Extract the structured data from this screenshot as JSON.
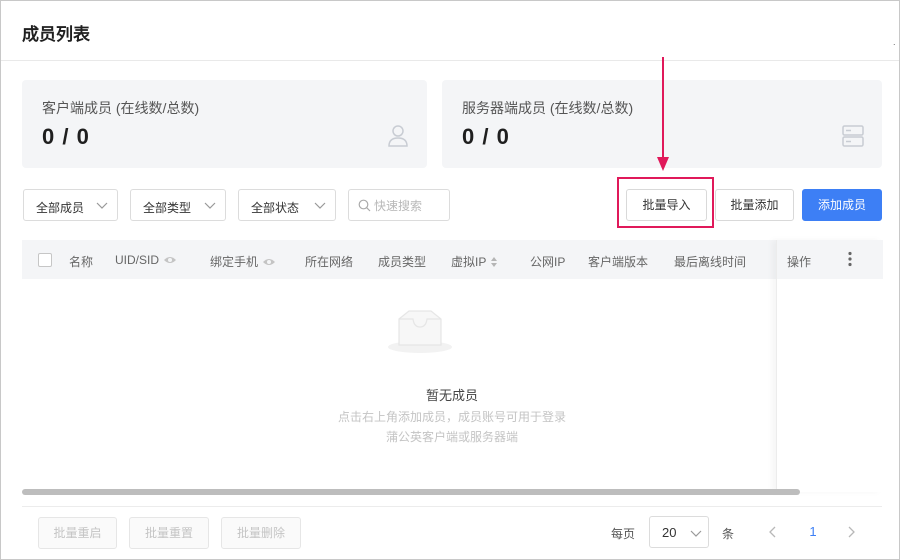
{
  "page": {
    "title": "成员列表",
    "edge_mark": "."
  },
  "stats": [
    {
      "label": "客户端成员 (在线数/总数)",
      "value": "0 / 0",
      "icon": "user-icon"
    },
    {
      "label": "服务器端成员 (在线数/总数)",
      "value": "0 / 0",
      "icon": "server-icon"
    }
  ],
  "filters": {
    "member": "全部成员",
    "type": "全部类型",
    "status": "全部状态",
    "search_placeholder": "快速搜索"
  },
  "actions": {
    "batch_import": "批量导入",
    "batch_add": "批量添加",
    "add_member": "添加成员"
  },
  "annotation": {
    "color": "#e0195a"
  },
  "table": {
    "columns": [
      "名称",
      "UID/SID",
      "绑定手机",
      "所在网络",
      "成员类型",
      "虚拟IP",
      "公网IP",
      "客户端版本",
      "最后离线时间"
    ],
    "ops_column": "操作"
  },
  "empty": {
    "title": "暂无成员",
    "line1": "点击右上角添加成员，成员账号可用于登录",
    "line2": "蒲公英客户端或服务器端"
  },
  "footer": {
    "batch_restart": "批量重启",
    "batch_reset": "批量重置",
    "batch_delete": "批量删除",
    "per_page_prefix": "每页",
    "page_size": "20",
    "per_page_suffix": "条",
    "current_page": "1"
  },
  "colors": {
    "primary": "#3d7ff5",
    "annotation": "#e0195a"
  }
}
